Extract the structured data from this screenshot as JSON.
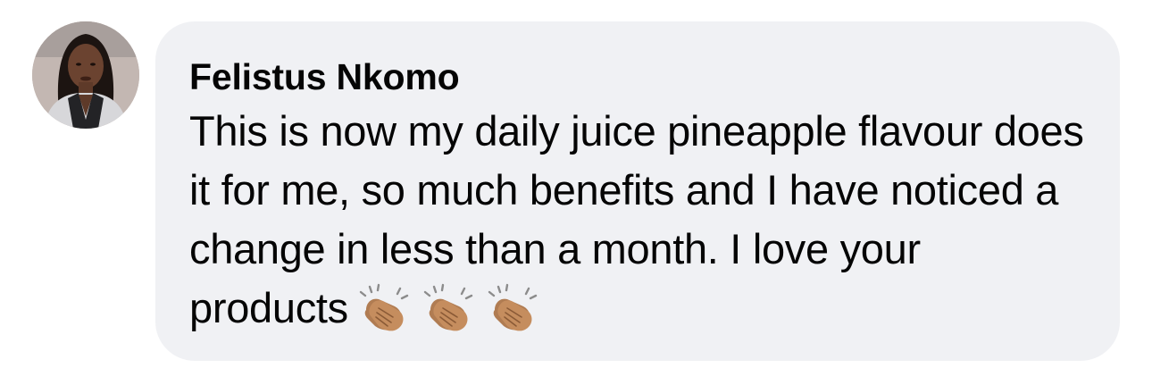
{
  "comment": {
    "author": "Felistus Nkomo",
    "text": "This is now my daily juice pineapple flavour does it for me, so much benefits and I have noticed a change in less than a month. I love your products",
    "emojis": [
      "clapping-hands",
      "clapping-hands",
      "clapping-hands"
    ]
  },
  "colors": {
    "bubble_background": "#f0f1f4",
    "text": "#050505",
    "emoji_skin": "#b07c52"
  }
}
